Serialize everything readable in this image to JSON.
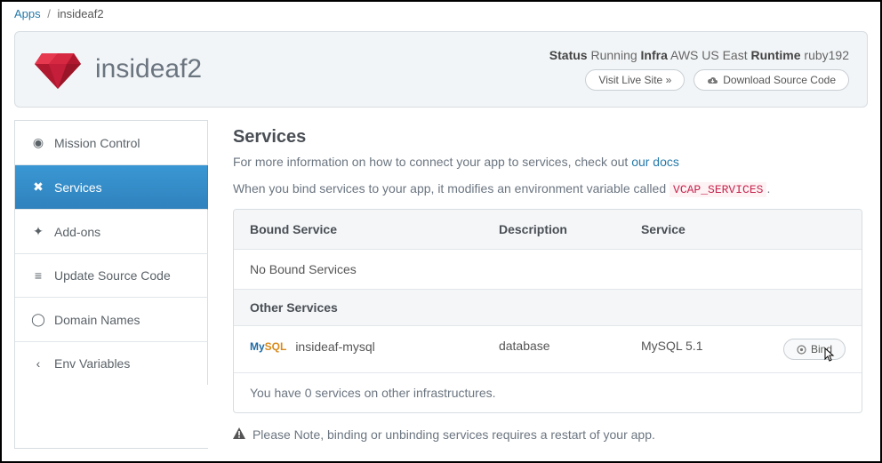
{
  "breadcrumb": {
    "root": "Apps",
    "current": "insideaf2"
  },
  "header": {
    "app_name": "insideaf2",
    "status_label": "Status",
    "status_value": "Running",
    "infra_label": "Infra",
    "infra_value": "AWS US East",
    "runtime_label": "Runtime",
    "runtime_value": "ruby192",
    "visit_button": "Visit Live Site »",
    "download_button": "Download Source Code"
  },
  "sidebar": {
    "items": [
      {
        "label": "Mission Control"
      },
      {
        "label": "Services"
      },
      {
        "label": "Add-ons"
      },
      {
        "label": "Update Source Code"
      },
      {
        "label": "Domain Names"
      },
      {
        "label": "Env Variables"
      }
    ]
  },
  "main": {
    "title": "Services",
    "info_text_pre": "For more information on how to connect your app to services, check out ",
    "info_link": "our docs",
    "bind_text_pre": "When you bind services to your app, it modifies an environment variable called ",
    "env_var": "VCAP_SERVICES",
    "bind_text_post": ".",
    "table": {
      "headers": {
        "col1": "Bound Service",
        "col2": "Description",
        "col3": "Service"
      },
      "no_bound": "No Bound Services",
      "other_heading": "Other Services",
      "rows": [
        {
          "name": "insideaf-mysql",
          "description": "database",
          "service": "MySQL 5.1",
          "action": "Bind"
        }
      ],
      "footer": "You have 0 services on other infrastructures."
    },
    "note": "Please Note, binding or unbinding services requires a restart of your app."
  }
}
